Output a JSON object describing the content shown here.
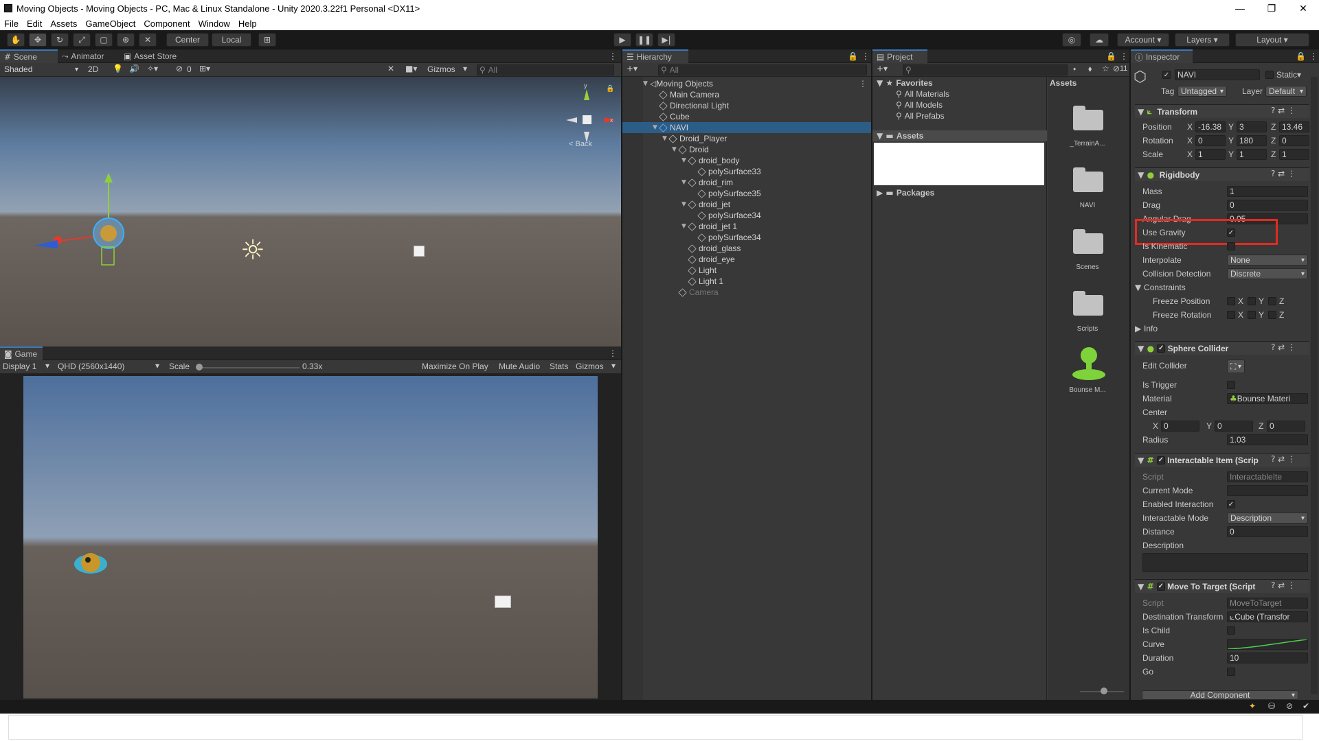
{
  "window": {
    "title": "Moving Objects - Moving Objects - PC, Mac & Linux Standalone - Unity 2020.3.22f1 Personal <DX11>"
  },
  "menu": [
    "File",
    "Edit",
    "Assets",
    "GameObject",
    "Component",
    "Window",
    "Help"
  ],
  "toolbar": {
    "center": "Center",
    "local": "Local",
    "account": "Account",
    "layers": "Layers",
    "layout": "Layout"
  },
  "scene": {
    "tabs": [
      "Scene",
      "Animator",
      "Asset Store"
    ],
    "shading": "Shaded",
    "mode2d": "2D",
    "hidden_count": "0",
    "gizmos": "Gizmos",
    "search_placeholder": "All",
    "back_label": "< Back"
  },
  "game": {
    "tab": "Game",
    "display": "Display 1",
    "resolution": "QHD (2560x1440)",
    "scale_label": "Scale",
    "scale_value": "0.33x",
    "scale_fraction": 0.0,
    "maximize": "Maximize On Play",
    "mute": "Mute Audio",
    "stats": "Stats",
    "gizmos": "Gizmos"
  },
  "hierarchy": {
    "tab": "Hierarchy",
    "search_placeholder": "All",
    "items": [
      {
        "label": "Moving Objects",
        "depth": 0,
        "icon": "unity-scene-icon",
        "arrow": "▼"
      },
      {
        "label": "Main Camera",
        "depth": 1
      },
      {
        "label": "Directional Light",
        "depth": 1
      },
      {
        "label": "Cube",
        "depth": 1
      },
      {
        "label": "NAVI",
        "depth": 1,
        "selected": true,
        "arrow": "▼"
      },
      {
        "label": "Droid_Player",
        "depth": 2,
        "arrow": "▼"
      },
      {
        "label": "Droid",
        "depth": 3,
        "arrow": "▼"
      },
      {
        "label": "droid_body",
        "depth": 4,
        "arrow": "▼"
      },
      {
        "label": "polySurface33",
        "depth": 5
      },
      {
        "label": "droid_rim",
        "depth": 4,
        "arrow": "▼"
      },
      {
        "label": "polySurface35",
        "depth": 5
      },
      {
        "label": "droid_jet",
        "depth": 4,
        "arrow": "▼"
      },
      {
        "label": "polySurface34",
        "depth": 5
      },
      {
        "label": "droid_jet 1",
        "depth": 4,
        "arrow": "▼"
      },
      {
        "label": "polySurface34",
        "depth": 5
      },
      {
        "label": "droid_glass",
        "depth": 4
      },
      {
        "label": "droid_eye",
        "depth": 4
      },
      {
        "label": "Light",
        "depth": 4
      },
      {
        "label": "Light 1",
        "depth": 4
      },
      {
        "label": "Camera",
        "depth": 3,
        "dim": true
      }
    ]
  },
  "project": {
    "tab": "Project",
    "hidden_count": "11",
    "favorites": "Favorites",
    "fav_items": [
      "All Materials",
      "All Models",
      "All Prefabs"
    ],
    "assets_label": "Assets",
    "packages_label": "Packages",
    "assets_header": "Assets",
    "asset_items": [
      "_TerrainA...",
      "NAVI",
      "Scenes",
      "Scripts",
      "Bounse M..."
    ]
  },
  "inspector": {
    "tab": "Inspector",
    "object_name": "NAVI",
    "static_label": "Static",
    "tag_label": "Tag",
    "tag_value": "Untagged",
    "layer_label": "Layer",
    "layer_value": "Default",
    "transform": {
      "title": "Transform",
      "position_label": "Position",
      "pos": [
        "-16.38",
        "3",
        "13.46"
      ],
      "rotation_label": "Rotation",
      "rot": [
        "0",
        "180",
        "0"
      ],
      "scale_label": "Scale",
      "scl": [
        "1",
        "1",
        "1"
      ]
    },
    "rigidbody": {
      "title": "Rigidbody",
      "mass_label": "Mass",
      "mass": "1",
      "drag_label": "Drag",
      "drag": "0",
      "angular_drag_label": "Angular Drag",
      "angular_drag": "0.05",
      "use_gravity_label": "Use Gravity",
      "is_kinematic_label": "Is Kinematic",
      "interpolate_label": "Interpolate",
      "interpolate": "None",
      "collision_label": "Collision Detection",
      "collision": "Discrete",
      "constraints_label": "Constraints",
      "freeze_pos_label": "Freeze Position",
      "freeze_rot_label": "Freeze Rotation",
      "info_label": "Info"
    },
    "sphere_collider": {
      "title": "Sphere Collider",
      "edit_label": "Edit Collider",
      "trigger_label": "Is Trigger",
      "material_label": "Material",
      "material": "Bounse Materi",
      "center_label": "Center",
      "center": [
        "0",
        "0",
        "0"
      ],
      "radius_label": "Radius",
      "radius": "1.03"
    },
    "interactable": {
      "title": "Interactable Item (Scrip",
      "script_label": "Script",
      "script": "InteractableIte",
      "mode_label": "Current Mode",
      "enabled_label": "Enabled Interaction",
      "imode_label": "Interactable Mode",
      "imode": "Description",
      "distance_label": "Distance",
      "distance": "0",
      "description_label": "Description"
    },
    "move_to_target": {
      "title": "Move To Target (Script",
      "script_label": "Script",
      "script": "MoveToTarget",
      "dest_label": "Destination Transform",
      "dest": "Cube (Transfor",
      "child_label": "Is Child",
      "curve_label": "Curve",
      "duration_label": "Duration",
      "duration": "10",
      "go_label": "Go"
    },
    "add_component": "Add Component"
  },
  "axes": {
    "x": "X",
    "y": "Y",
    "z": "Z"
  },
  "colors": {
    "highlight": "#e52a20",
    "selection": "#2c5d87",
    "accent": "#3a79bb"
  }
}
